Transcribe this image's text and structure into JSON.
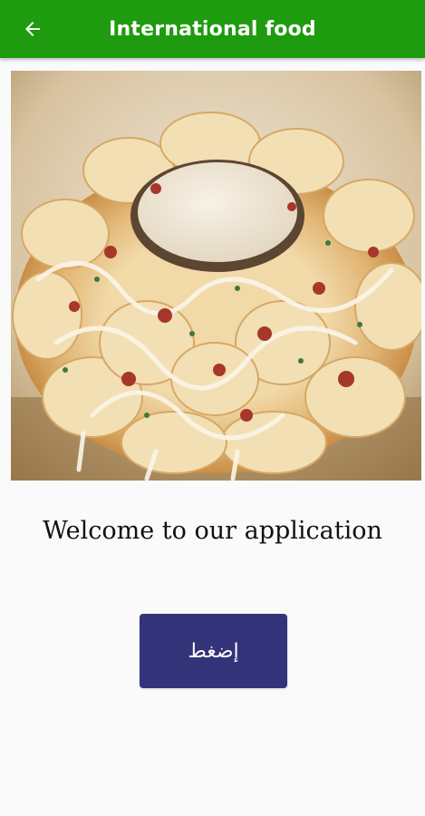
{
  "app_bar": {
    "title": "International food",
    "back_icon": "arrow-left-icon",
    "color": "#1e9b0e"
  },
  "hero_image": {
    "subject": "pull-apart bread ring with cheese, bacon and a dipping sauce bowl"
  },
  "main": {
    "welcome_text": "Welcome to our application",
    "button_label": "إضغط",
    "button_color": "#323378"
  }
}
